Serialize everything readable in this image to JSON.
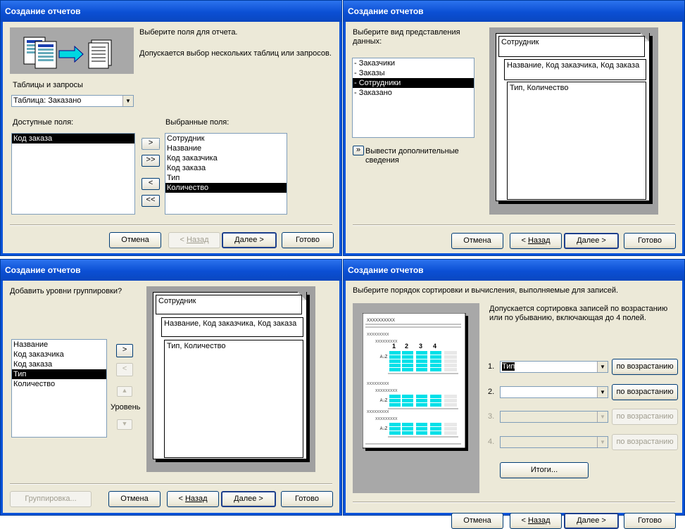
{
  "window_title": "Создание отчетов",
  "common_buttons": {
    "cancel": "Отмена",
    "back_prefix": "< ",
    "back": "Назад",
    "next": "Далее >",
    "finish": "Готово"
  },
  "panel1": {
    "intro": "Выберите поля для отчета.",
    "hint": "Допускается выбор нескольких таблиц или запросов.",
    "tables_label": "Таблицы и запросы",
    "tables_value": "Таблица: Заказано",
    "available_label": "Доступные поля:",
    "available": [
      {
        "text": "Код заказа",
        "selected": true
      }
    ],
    "selected_label": "Выбранные поля:",
    "selected": [
      {
        "text": "Сотрудник",
        "selected": false
      },
      {
        "text": "Название",
        "selected": false
      },
      {
        "text": "Код заказчика",
        "selected": false
      },
      {
        "text": "Код заказа",
        "selected": false
      },
      {
        "text": "Тип",
        "selected": false
      },
      {
        "text": "Количество",
        "selected": true
      }
    ],
    "move_buttons": [
      ">",
      ">>",
      "<",
      "<<"
    ]
  },
  "panel2": {
    "prompt": "Выберите вид представления данных:",
    "views": [
      {
        "text": "- Заказчики",
        "selected": false
      },
      {
        "text": "- Заказы",
        "selected": false
      },
      {
        "text": "- Сотрудники",
        "selected": true
      },
      {
        "text": "- Заказано",
        "selected": false
      }
    ],
    "more_button": "»",
    "more_label": "Вывести дополнительные сведения",
    "preview": {
      "level1": "Сотрудник",
      "level2": "Название, Код заказчика, Код заказа",
      "level3": "Тип, Количество"
    }
  },
  "panel3": {
    "prompt": "Добавить уровни группировки?",
    "fields": [
      {
        "text": "Название",
        "selected": false
      },
      {
        "text": "Код заказчика",
        "selected": false
      },
      {
        "text": "Код заказа",
        "selected": false
      },
      {
        "text": "Тип",
        "selected": true
      },
      {
        "text": "Количество",
        "selected": false
      }
    ],
    "buttons": {
      "add": ">",
      "remove": "<",
      "up": "▲",
      "down": "▼"
    },
    "level_label": "Уровень",
    "grouping_button": "Группировка...",
    "preview": {
      "level1": "Сотрудник",
      "level2": "Название, Код заказчика, Код заказа",
      "level3": "Тип, Количество"
    }
  },
  "panel4": {
    "prompt": "Выберите порядок сортировки и вычисления, выполняемые для записей.",
    "hint": "Допускается сортировка записей по возрастанию или по убыванию, включающая до 4 полей.",
    "sorts": [
      {
        "num": "1.",
        "value": "Тип",
        "order": "по возрастанию",
        "enabled": true
      },
      {
        "num": "2.",
        "value": "",
        "order": "по возрастанию",
        "enabled": true
      },
      {
        "num": "3.",
        "value": "",
        "order": "по возрастанию",
        "enabled": false
      },
      {
        "num": "4.",
        "value": "",
        "order": "по возрастанию",
        "enabled": false
      }
    ],
    "totals_button": "Итоги...",
    "thumb_header": "xxxxxxxxxx",
    "thumb_cols": [
      "1",
      "2",
      "3",
      "4"
    ],
    "thumb_placeholder": "xxxxxxxxx",
    "thumb_sort_glyph": "A↓Z"
  },
  "colors": {
    "title_bar": "#0a53d9",
    "face": "#ece9d8",
    "selection": "#000000",
    "thumb_cells": "#00e0e8"
  }
}
